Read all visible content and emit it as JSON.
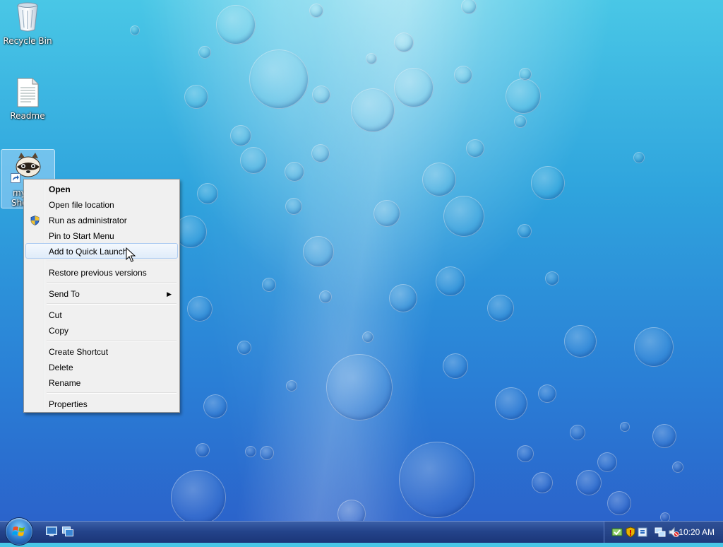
{
  "desktop": {
    "icons": [
      {
        "label": "Recycle Bin"
      },
      {
        "label": "Readme"
      },
      {
        "label": "my",
        "label_line2": "Sho"
      }
    ]
  },
  "context_menu": {
    "items": [
      {
        "label": "Open"
      },
      {
        "label": "Open file location"
      },
      {
        "label": "Run as administrator"
      },
      {
        "label": "Pin to Start Menu"
      },
      {
        "label": "Add to Quick Launch"
      },
      {
        "label": "Restore previous versions"
      },
      {
        "label": "Send To"
      },
      {
        "label": "Cut"
      },
      {
        "label": "Copy"
      },
      {
        "label": "Create Shortcut"
      },
      {
        "label": "Delete"
      },
      {
        "label": "Rename"
      },
      {
        "label": "Properties"
      }
    ]
  },
  "taskbar": {
    "clock": "10:20 AM"
  }
}
